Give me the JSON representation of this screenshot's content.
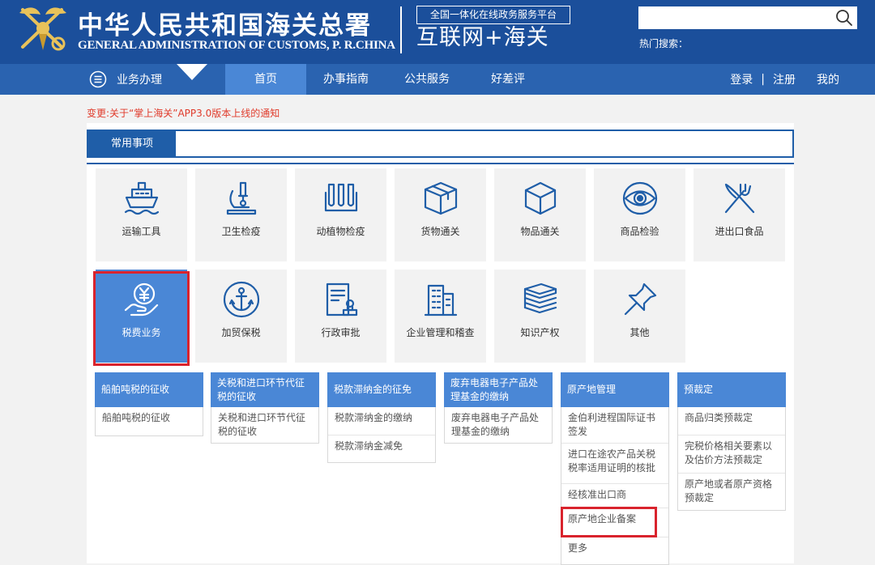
{
  "header": {
    "title_cn": "中华人民共和国海关总署",
    "title_en": "GENERAL ADMINISTRATION OF CUSTOMS, P. R.CHINA",
    "platform_tag": "全国一体化在线政务服务平台",
    "platform_name": "互联网+海关",
    "hot_search_label": "热门搜索：",
    "search_placeholder": ""
  },
  "nav": {
    "business_menu": "业务办理",
    "items": [
      {
        "label": "首页",
        "active": true
      },
      {
        "label": "办事指南",
        "active": false
      },
      {
        "label": "公共服务",
        "active": false
      },
      {
        "label": "好差评",
        "active": false
      }
    ],
    "login": "登录",
    "separator": "|",
    "register": "注册",
    "mine": "我的"
  },
  "notice": "变更:关于“掌上海关”APP3.0版本上线的通知",
  "common": {
    "tab_label": "常用事项",
    "tiles": [
      {
        "label": "运输工具",
        "icon": "ship-icon"
      },
      {
        "label": "卫生检疫",
        "icon": "microscope-icon"
      },
      {
        "label": "动植物检疫",
        "icon": "test-tubes-icon"
      },
      {
        "label": "货物通关",
        "icon": "open-box-icon"
      },
      {
        "label": "物品通关",
        "icon": "cube-icon"
      },
      {
        "label": "商品检验",
        "icon": "eye-icon"
      },
      {
        "label": "进出口食品",
        "icon": "cutlery-icon"
      },
      {
        "label": "税费业务",
        "icon": "yen-hand-icon",
        "selected": true
      },
      {
        "label": "加贸保税",
        "icon": "anchor-icon"
      },
      {
        "label": "行政审批",
        "icon": "document-stamp-icon"
      },
      {
        "label": "企业管理和稽查",
        "icon": "building-icon"
      },
      {
        "label": "知识产权",
        "icon": "books-icon"
      },
      {
        "label": "其他",
        "icon": "pin-icon"
      }
    ]
  },
  "subcategories": [
    {
      "title": "船舶吨税的征收",
      "items": [
        "船舶吨税的征收"
      ]
    },
    {
      "title": "关税和进口环节代征税的征收",
      "items": [
        "关税和进口环节代征税的征收"
      ]
    },
    {
      "title": "税款滞纳金的征免",
      "items": [
        "税款滞纳金的缴纳",
        "税款滞纳金减免"
      ]
    },
    {
      "title": "废弃电器电子产品处理基金的缴纳",
      "items": [
        "废弃电器电子产品处理基金的缴纳"
      ]
    },
    {
      "title": "原产地管理",
      "items": [
        "金伯利进程国际证书签发",
        "进口在途农产品关税税率适用证明的核批",
        "经核准出口商",
        "原产地企业备案",
        "更多"
      ]
    },
    {
      "title": "预裁定",
      "items": [
        "商品归类预裁定",
        "完税价格相关要素以及估价方法预裁定",
        "原产地或者原产资格预裁定"
      ]
    }
  ],
  "colors": {
    "header_bg": "#1b4f9b",
    "nav_bg": "#2a63b0",
    "accent": "#4a87d6",
    "notice": "#e03b2b",
    "highlight": "#d9232d"
  }
}
